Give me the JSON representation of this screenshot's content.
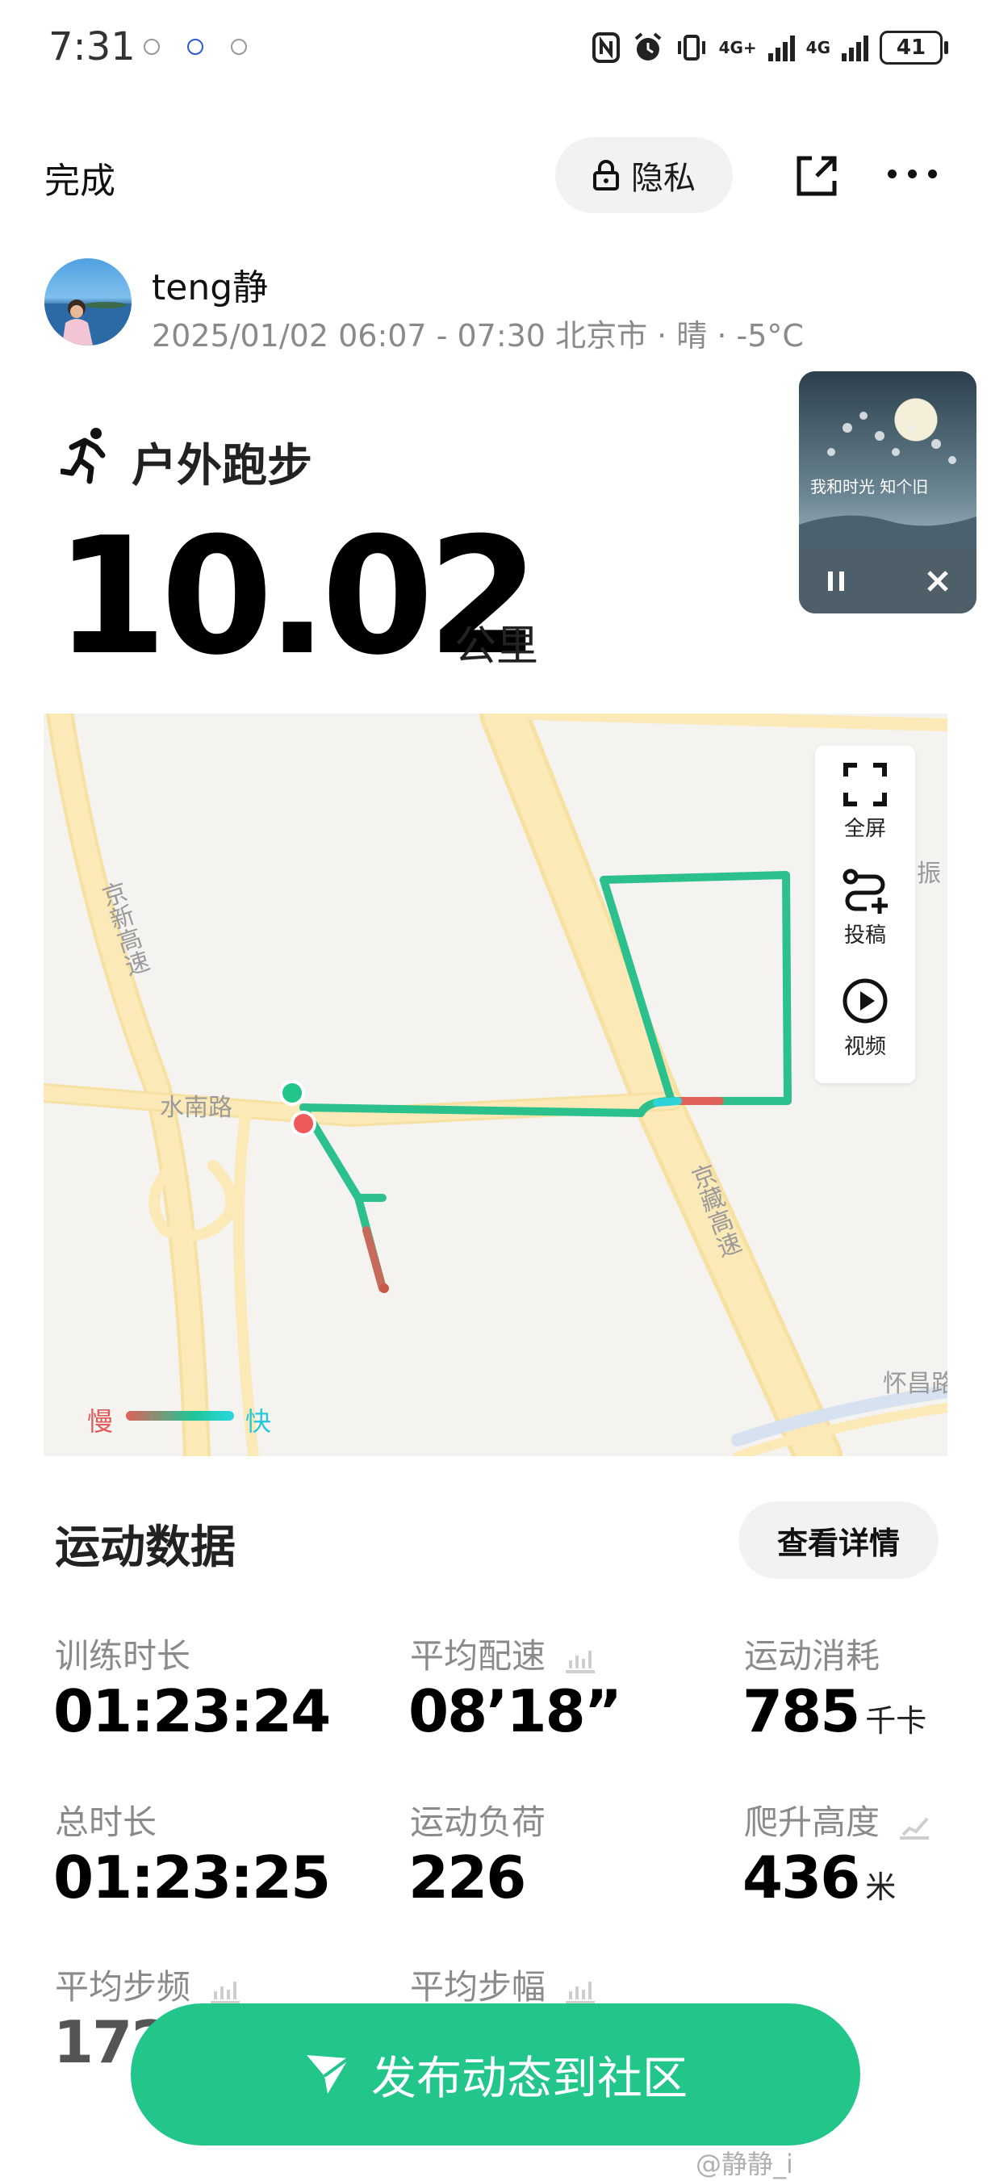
{
  "status_bar": {
    "time": "7:31",
    "battery": "41",
    "network_1": "4G+",
    "network_2": "4G"
  },
  "nav": {
    "done_label": "完成",
    "privacy_label": "隐私"
  },
  "profile": {
    "name": "teng静",
    "meta": "2025/01/02 06:07 - 07:30 北京市 · 晴 · -5°C"
  },
  "player": {
    "art_text": "我和时光 知个旧"
  },
  "activity": {
    "title": "户外跑步",
    "distance": "10.02",
    "unit": "公里"
  },
  "map": {
    "controls": {
      "fullscreen": "全屏",
      "submit": "投稿",
      "video": "视频"
    },
    "roads": {
      "jingxin": "京新高速",
      "shuinan": "水南路",
      "jingzang": "京藏高速",
      "huaichang": "怀昌路",
      "zhen": "振"
    },
    "legend": {
      "slow": "慢",
      "fast": "快"
    }
  },
  "stats": {
    "title": "运动数据",
    "details_label": "查看详情",
    "items": [
      {
        "label": "训练时长",
        "value": "01:23:24",
        "unit": ""
      },
      {
        "label": "平均配速",
        "value": "08’18”",
        "unit": ""
      },
      {
        "label": "运动消耗",
        "value": "785",
        "unit": "千卡"
      },
      {
        "label": "总时长",
        "value": "01:23:25",
        "unit": ""
      },
      {
        "label": "运动负荷",
        "value": "226",
        "unit": ""
      },
      {
        "label": "爬升高度",
        "value": "436",
        "unit": "米"
      },
      {
        "label": "平均步频",
        "value": "172",
        "unit": ""
      },
      {
        "label": "平均步幅",
        "value": "",
        "unit": ""
      }
    ]
  },
  "publish": {
    "label": "发布动态到社区"
  },
  "watermark": "@静静_i"
}
